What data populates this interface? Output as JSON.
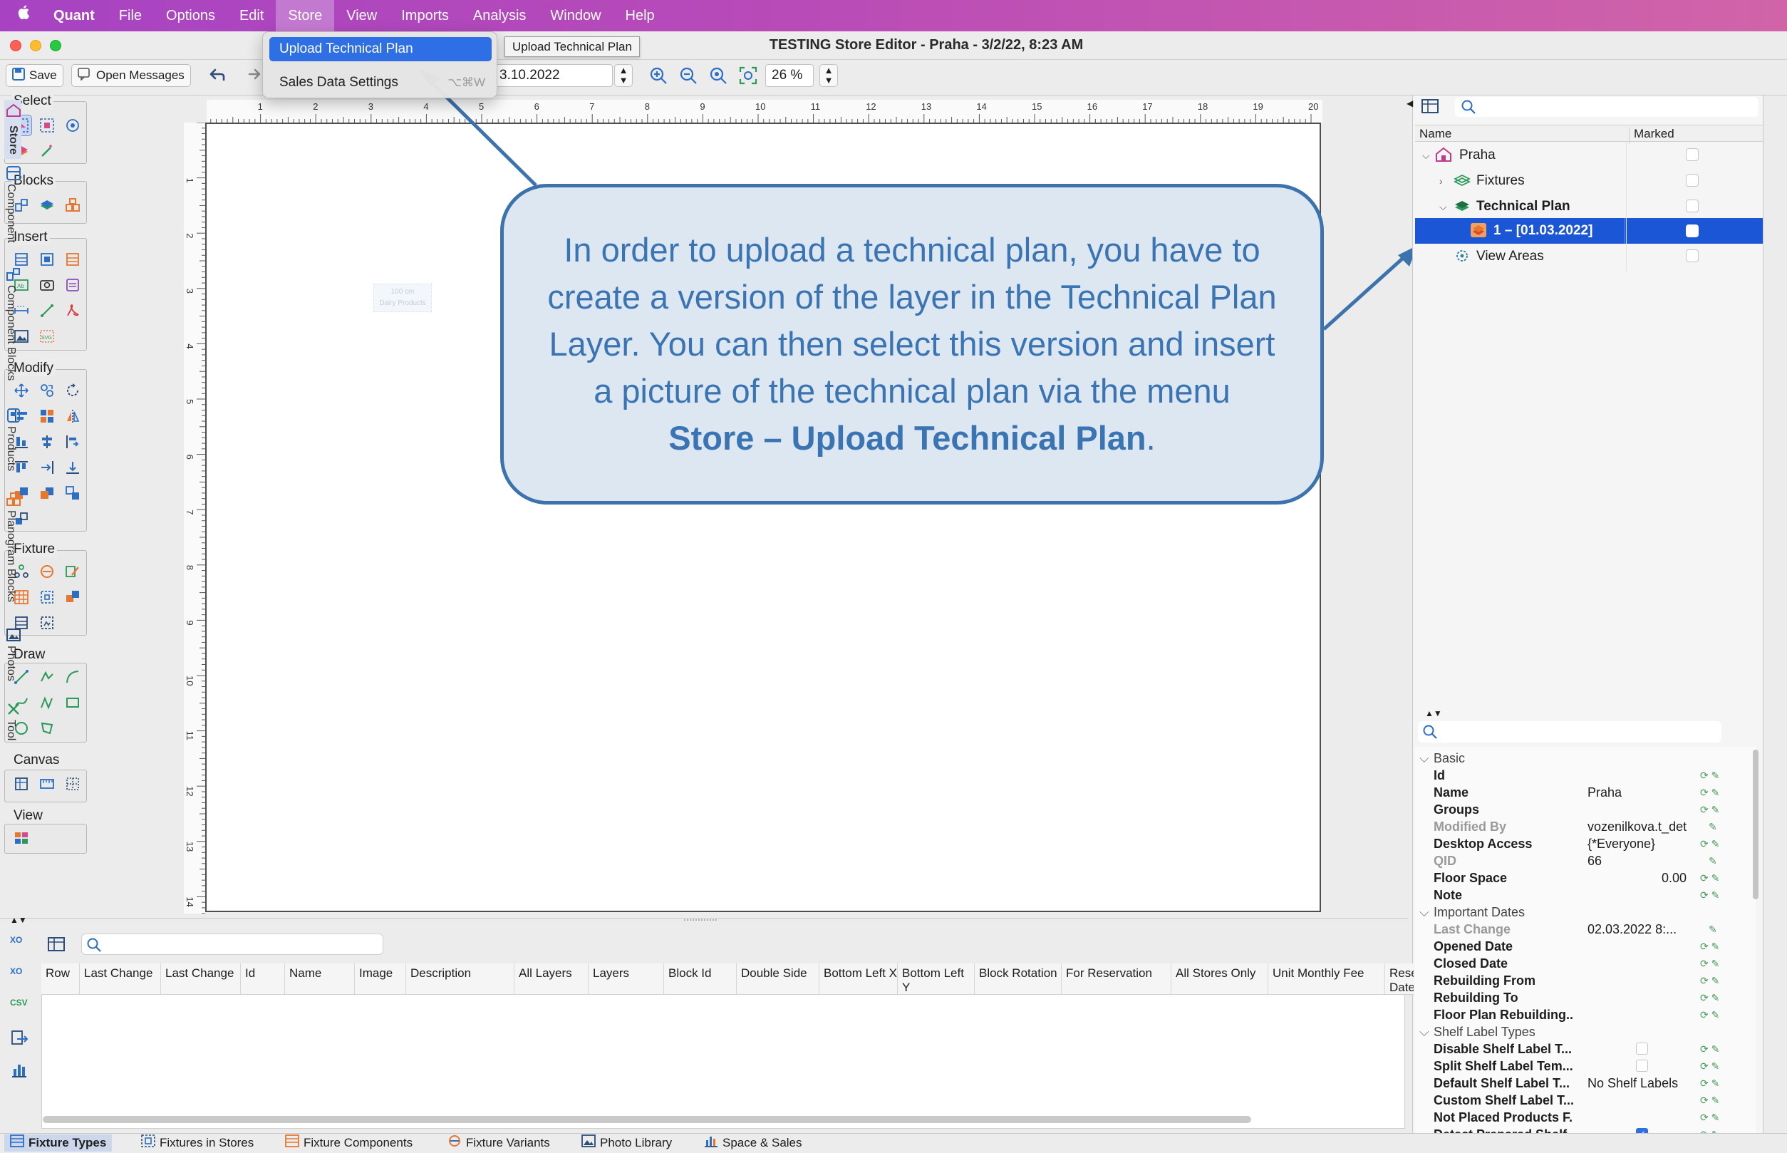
{
  "menubar": {
    "apple": "",
    "app": "Quant",
    "items": [
      "File",
      "Options",
      "Edit",
      "Store",
      "View",
      "Imports",
      "Analysis",
      "Window",
      "Help"
    ],
    "active": "Store"
  },
  "window": {
    "title": "TESTING Store Editor - Praha - 3/2/22, 8:23 AM"
  },
  "toolbar": {
    "save_label": "Save",
    "messages_label": "Open Messages",
    "date_value": "3.10.2022",
    "zoom_value": "26 %"
  },
  "store_menu": {
    "item1": "Upload Technical Plan",
    "item2": "Sales Data Settings",
    "item2_shortcut": "⌥⌘W",
    "tooltip": "Upload Technical Plan"
  },
  "palette": {
    "select": "Select",
    "blocks": "Blocks",
    "insert": "Insert",
    "modify": "Modify",
    "fixture": "Fixture",
    "draw": "Draw",
    "canvas": "Canvas",
    "view": "View"
  },
  "rulers": {
    "top": [
      "1",
      "2",
      "3",
      "4",
      "5",
      "6",
      "7",
      "8",
      "9",
      "10",
      "11",
      "12",
      "13",
      "14",
      "15",
      "16",
      "17",
      "18",
      "19",
      "20"
    ],
    "left": [
      "1",
      "2",
      "3",
      "4",
      "5",
      "6",
      "7",
      "8",
      "9",
      "10",
      "11",
      "12",
      "13",
      "14"
    ]
  },
  "canvas": {
    "ghost_line1": "100 cm",
    "ghost_line2": "Dairy Products"
  },
  "callout": {
    "text_before": "In order to upload a technical plan, you have to create a version of the layer in the Technical Plan Layer. You can then select this version and insert a picture of the technical plan via the menu ",
    "bold": "Store – Upload Technical Plan",
    "text_after": "."
  },
  "tree": {
    "col_name": "Name",
    "col_marked": "Marked",
    "rows": [
      {
        "label": "Praha"
      },
      {
        "label": "Fixtures"
      },
      {
        "label": "Technical Plan"
      },
      {
        "label": "1 – [01.03.2022]"
      },
      {
        "label": "View Areas"
      }
    ]
  },
  "properties": {
    "groups": {
      "basic": "Basic",
      "dates": "Important Dates",
      "shelf": "Shelf Label Types"
    },
    "rows": [
      {
        "k": "Id",
        "v": ""
      },
      {
        "k": "Name",
        "v": "Praha"
      },
      {
        "k": "Groups",
        "v": ""
      },
      {
        "k": "Modified By",
        "v": "vozenilkova.t_det"
      },
      {
        "k": "Desktop Access",
        "v": "{*Everyone}"
      },
      {
        "k": "QID",
        "v": "66"
      },
      {
        "k": "Floor Space",
        "v": "0.00"
      },
      {
        "k": "Note",
        "v": ""
      },
      {
        "k": "Last Change",
        "v": "02.03.2022 8:..."
      },
      {
        "k": "Opened Date",
        "v": ""
      },
      {
        "k": "Closed Date",
        "v": ""
      },
      {
        "k": "Rebuilding From",
        "v": ""
      },
      {
        "k": "Rebuilding To",
        "v": ""
      },
      {
        "k": "Floor Plan Rebuilding...",
        "v": ""
      },
      {
        "k": "Disable Shelf Label T...",
        "v": ""
      },
      {
        "k": "Split Shelf Label Tem...",
        "v": ""
      },
      {
        "k": "Default Shelf Label T...",
        "v": "No Shelf Labels"
      },
      {
        "k": "Custom Shelf Label T...",
        "v": ""
      },
      {
        "k": "Not Placed Products F...",
        "v": ""
      },
      {
        "k": "Detect Prepared Shelf...",
        "v": ""
      }
    ]
  },
  "vtabs": [
    "Store",
    "Component",
    "Component Blocks",
    "Products",
    "Planogram Blocks",
    "Photos",
    "Tool"
  ],
  "table": {
    "columns": [
      "Row",
      "Last Change",
      "Last Change",
      "Id",
      "Name",
      "Image",
      "Description",
      "All Layers",
      "Layers",
      "Block Id",
      "Double Side",
      "Bottom Left X",
      "Bottom Left Y",
      "Block Rotation",
      "For Reservation",
      "All Stores Only",
      "Unit Monthly Fee",
      "Rese Date"
    ]
  },
  "left_icons": {
    "xo1": "XO",
    "xo2": "XO",
    "csv": "CSV"
  },
  "status_tabs": [
    "Fixture Types",
    "Fixtures in Stores",
    "Fixture Components",
    "Fixture Variants",
    "Photo Library",
    "Space & Sales"
  ],
  "colors": {
    "menubar_start": "#a743c2",
    "menubar_end": "#d164a8",
    "accent": "#2f6fe6",
    "callout_border": "#3d73ac",
    "callout_text": "#3a74b2",
    "selection": "#1a56d6"
  }
}
